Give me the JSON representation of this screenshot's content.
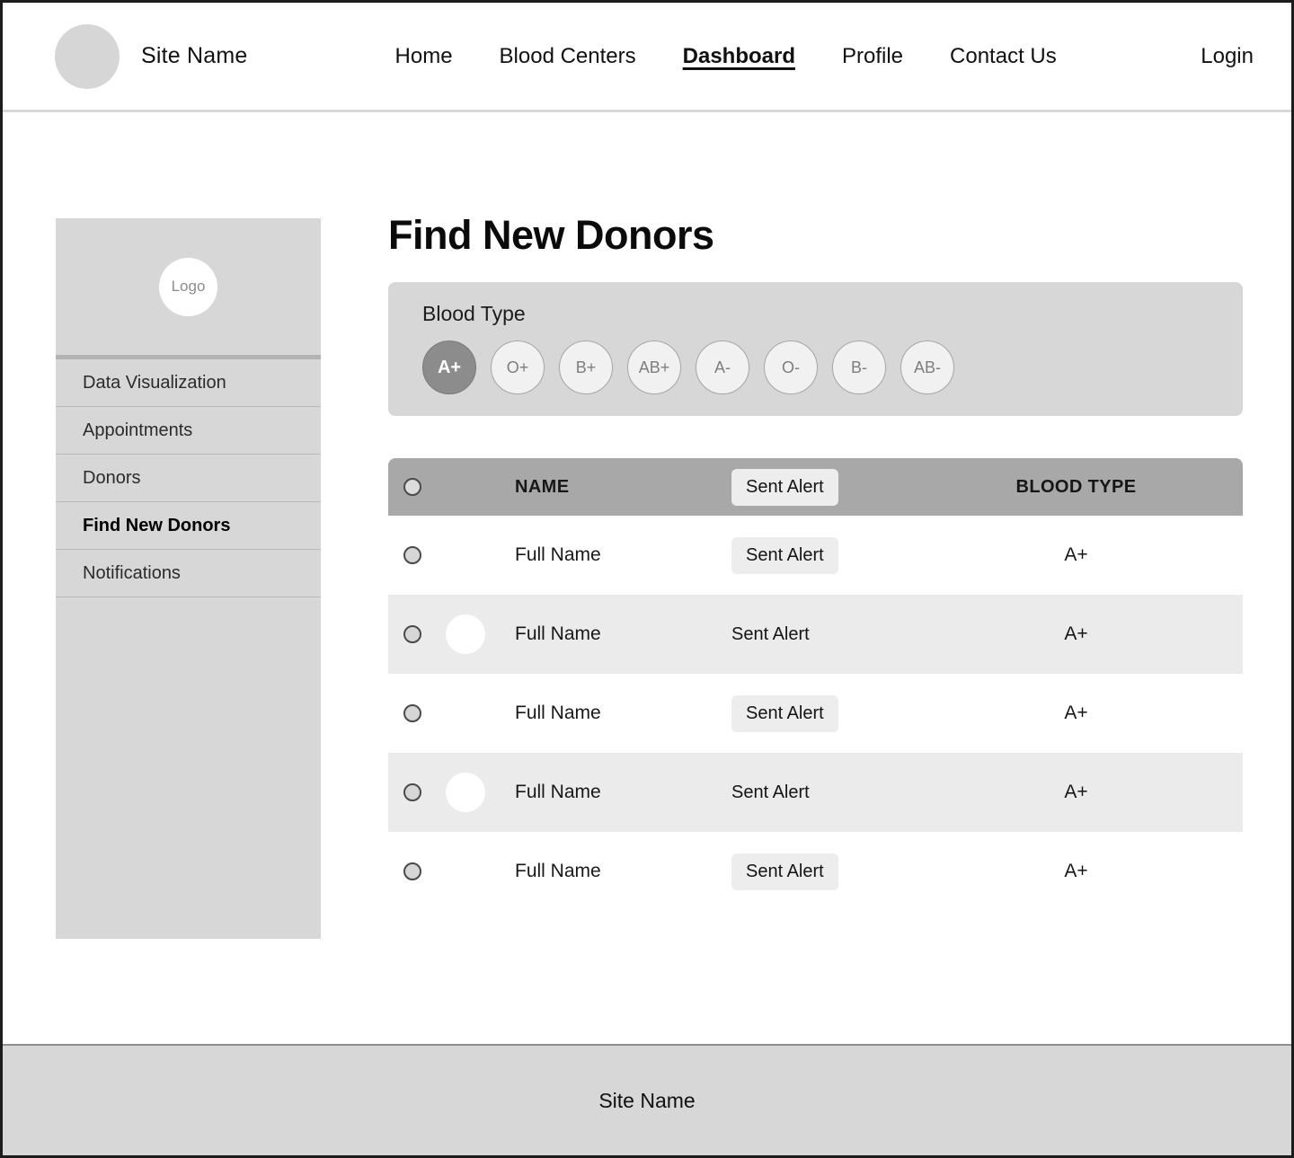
{
  "topnav": {
    "brand_logo_icon": "circle-avatar-icon",
    "brand_name": "Site Name",
    "links": [
      {
        "label": "Home",
        "active": false
      },
      {
        "label": "Blood Centers",
        "active": false
      },
      {
        "label": "Dashboard",
        "active": true
      },
      {
        "label": "Profile",
        "active": false
      },
      {
        "label": "Contact Us",
        "active": false
      }
    ],
    "login_label": "Login"
  },
  "sidebar": {
    "logo_label": "Logo",
    "items": [
      {
        "label": "Data Visualization",
        "active": false
      },
      {
        "label": "Appointments",
        "active": false
      },
      {
        "label": "Donors",
        "active": false
      },
      {
        "label": "Find New Donors",
        "active": true
      },
      {
        "label": "Notifications",
        "active": false
      }
    ]
  },
  "main": {
    "page_title": "Find New Donors",
    "filter": {
      "label": "Blood Type",
      "options": [
        {
          "label": "A+",
          "selected": true
        },
        {
          "label": "O+",
          "selected": false
        },
        {
          "label": "B+",
          "selected": false
        },
        {
          "label": "AB+",
          "selected": false
        },
        {
          "label": "A-",
          "selected": false
        },
        {
          "label": "O-",
          "selected": false
        },
        {
          "label": "B-",
          "selected": false
        },
        {
          "label": "AB-",
          "selected": false
        }
      ]
    },
    "table": {
      "header": {
        "select_all_icon": "radio-unchecked-icon",
        "name": "NAME",
        "alert": "Sent Alert",
        "blood_type": "BLOOD TYPE"
      },
      "rows": [
        {
          "name": "Full Name",
          "alert": "Sent Alert",
          "blood_type": "A+",
          "shaded": false,
          "avatar": false,
          "alert_flat": false
        },
        {
          "name": "Full Name",
          "alert": "Sent Alert",
          "blood_type": "A+",
          "shaded": true,
          "avatar": true,
          "alert_flat": true
        },
        {
          "name": "Full Name",
          "alert": "Sent Alert",
          "blood_type": "A+",
          "shaded": false,
          "avatar": false,
          "alert_flat": false
        },
        {
          "name": "Full Name",
          "alert": "Sent Alert",
          "blood_type": "A+",
          "shaded": true,
          "avatar": true,
          "alert_flat": true
        },
        {
          "name": "Full Name",
          "alert": "Sent Alert",
          "blood_type": "A+",
          "shaded": false,
          "avatar": false,
          "alert_flat": false
        }
      ]
    }
  },
  "footer": {
    "site_name": "Site Name"
  },
  "colors": {
    "panel_gray": "#d7d7d7",
    "table_header_gray": "#a8a8a8",
    "row_shaded": "#ebebeb",
    "pill_selected": "#8c8c8c",
    "pill_unselected": "#f1f1f1",
    "chip_gray": "#ededed",
    "page_border": "#1c1c1c"
  }
}
